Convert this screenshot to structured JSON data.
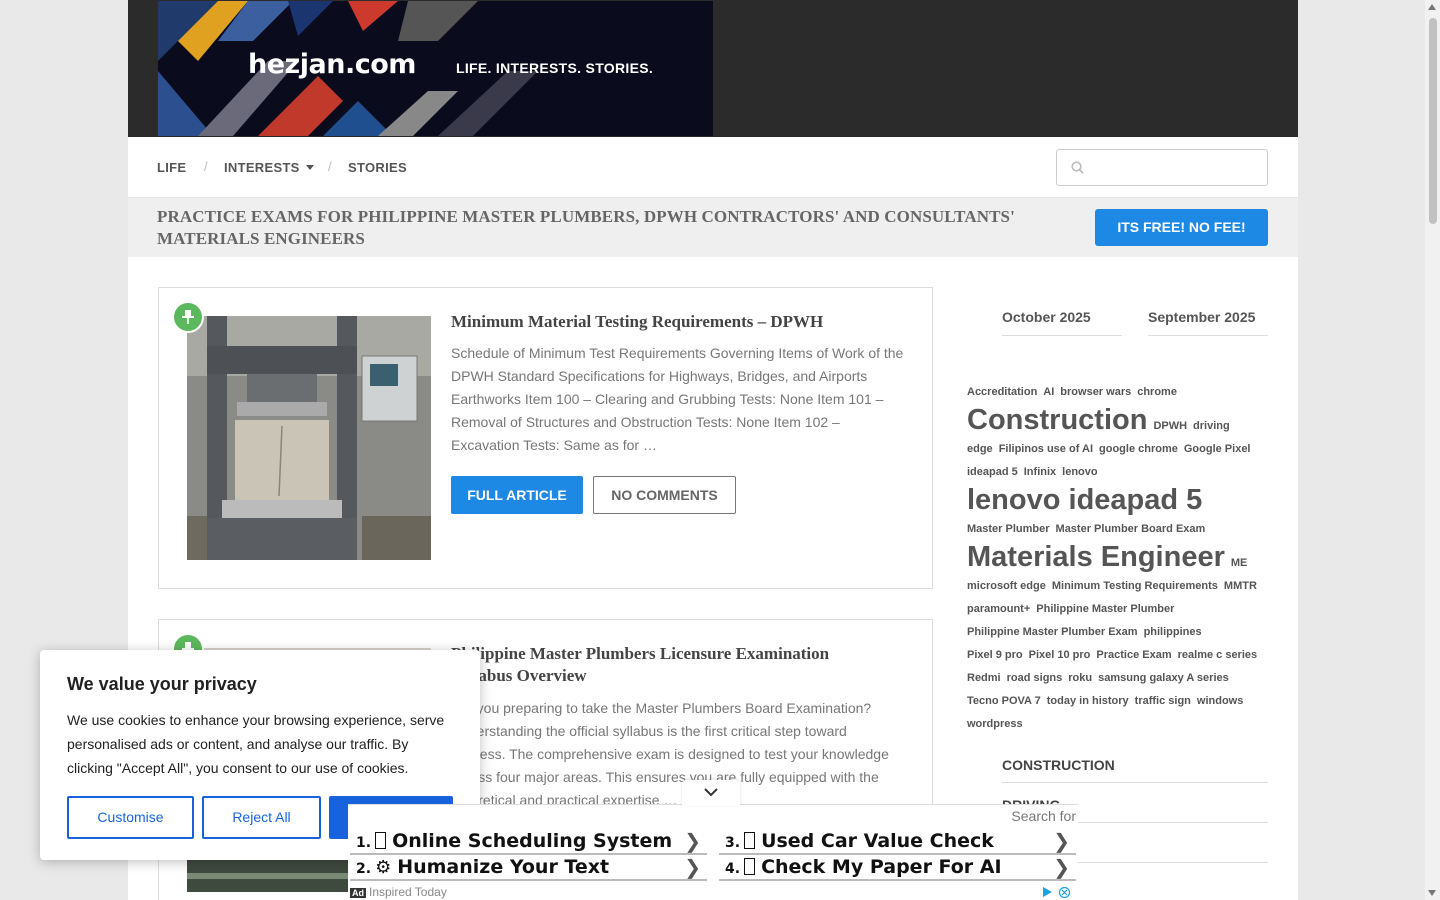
{
  "header": {
    "logo_name": "hezjan.com",
    "logo_tagline": "LIFE. INTERESTS. STORIES."
  },
  "nav": {
    "items": [
      "LIFE",
      "INTERESTS",
      "STORIES"
    ],
    "separator": "/",
    "search_placeholder": ""
  },
  "promo": {
    "text": "PRACTICE EXAMS FOR PHILIPPINE MASTER PLUMBERS, DPWH CONTRACTORS' AND CONSULTANTS' MATERIALS ENGINEERS",
    "button": "ITS FREE! NO FEE!"
  },
  "posts": [
    {
      "title": "Minimum Material Testing Requirements – DPWH",
      "excerpt": "Schedule of Minimum Test Requirements Governing Items of Work of the DPWH Standard Specifications for Highways, Bridges, and Airports Earthworks Item 100 – Clearing and Grubbing Tests: None Item 101 – Removal of Structures and Obstruction Tests: None Item 102 – Excavation Tests: Same as for …",
      "primary_button": "FULL ARTICLE",
      "comments_button": "NO COMMENTS"
    },
    {
      "title": "Philippine Master Plumbers Licensure Examination Syllabus Overview",
      "excerpt": "Are you preparing to take the Master Plumbers Board Examination? Understanding the official syllabus is the first critical step toward success. The comprehensive exam is designed to test your knowledge across four major areas. This ensures you are fully equipped with the theoretical and practical expertise …"
    }
  ],
  "sidebar": {
    "archive_tabs": [
      "October 2025",
      "September 2025"
    ],
    "tags": [
      {
        "label": "Accreditation",
        "size": 11
      },
      {
        "label": "AI",
        "size": 11
      },
      {
        "label": "browser wars",
        "size": 11
      },
      {
        "label": "chrome",
        "size": 11
      },
      {
        "label": "Construction",
        "size": 29
      },
      {
        "label": "DPWH",
        "size": 11
      },
      {
        "label": "driving",
        "size": 11
      },
      {
        "label": "edge",
        "size": 11
      },
      {
        "label": "Filipinos use of AI",
        "size": 11
      },
      {
        "label": "google chrome",
        "size": 11
      },
      {
        "label": "Google Pixel",
        "size": 11
      },
      {
        "label": "ideapad 5",
        "size": 11
      },
      {
        "label": "Infinix",
        "size": 11
      },
      {
        "label": "lenovo",
        "size": 11
      },
      {
        "label": "lenovo ideapad 5",
        "size": 29
      },
      {
        "label": "Master Plumber",
        "size": 11
      },
      {
        "label": "Master Plumber Board Exam",
        "size": 11
      },
      {
        "label": "Materials Engineer",
        "size": 29
      },
      {
        "label": "ME",
        "size": 11
      },
      {
        "label": "microsoft edge",
        "size": 11
      },
      {
        "label": "Minimum Testing Requirements",
        "size": 11
      },
      {
        "label": "MMTR",
        "size": 11
      },
      {
        "label": "paramount+",
        "size": 11
      },
      {
        "label": "Philippine Master Plumber",
        "size": 11
      },
      {
        "label": "Philippine Master Plumber Exam",
        "size": 11
      },
      {
        "label": "philippines",
        "size": 11
      },
      {
        "label": "Pixel 9 pro",
        "size": 11
      },
      {
        "label": "Pixel 10 pro",
        "size": 11
      },
      {
        "label": "Practice Exam",
        "size": 11
      },
      {
        "label": "realme c series",
        "size": 11
      },
      {
        "label": "Redmi",
        "size": 11
      },
      {
        "label": "road signs",
        "size": 11
      },
      {
        "label": "roku",
        "size": 11
      },
      {
        "label": "samsung galaxy A series",
        "size": 11
      },
      {
        "label": "Tecno POVA 7",
        "size": 11
      },
      {
        "label": "today in history",
        "size": 11
      },
      {
        "label": "traffic sign",
        "size": 11
      },
      {
        "label": "windows",
        "size": 11
      },
      {
        "label": "wordpress",
        "size": 11
      }
    ],
    "categories": [
      "CONSTRUCTION",
      "DRIVING"
    ]
  },
  "cookie": {
    "title": "We value your privacy",
    "text": "We use cookies to enhance your browsing experience, serve personalised ads or content, and analyse our traffic. By clicking \"Accept All\", you consent to our use of cookies.",
    "customise": "Customise",
    "reject": "Reject All",
    "accept": ""
  },
  "ad": {
    "search_for": "Search for",
    "items": [
      {
        "num": "1.",
        "label": "Online Scheduling System",
        "icon": "box-glyph-icon"
      },
      {
        "num": "3.",
        "label": "Used Car Value Check",
        "icon": "box-glyph-icon"
      },
      {
        "num": "2.",
        "label": "Humanize Your Text",
        "icon": "gear-icon"
      },
      {
        "num": "4.",
        "label": "Check My Paper For AI",
        "icon": "box-glyph-icon"
      }
    ],
    "arrow": "❯",
    "badge": "Ad",
    "footer": "Inspired Today"
  },
  "colors": {
    "accent": "#1e88e5",
    "header_bg": "#2b2b2b",
    "pin": "#5cb85c",
    "cookie_accent": "#1863dc"
  }
}
